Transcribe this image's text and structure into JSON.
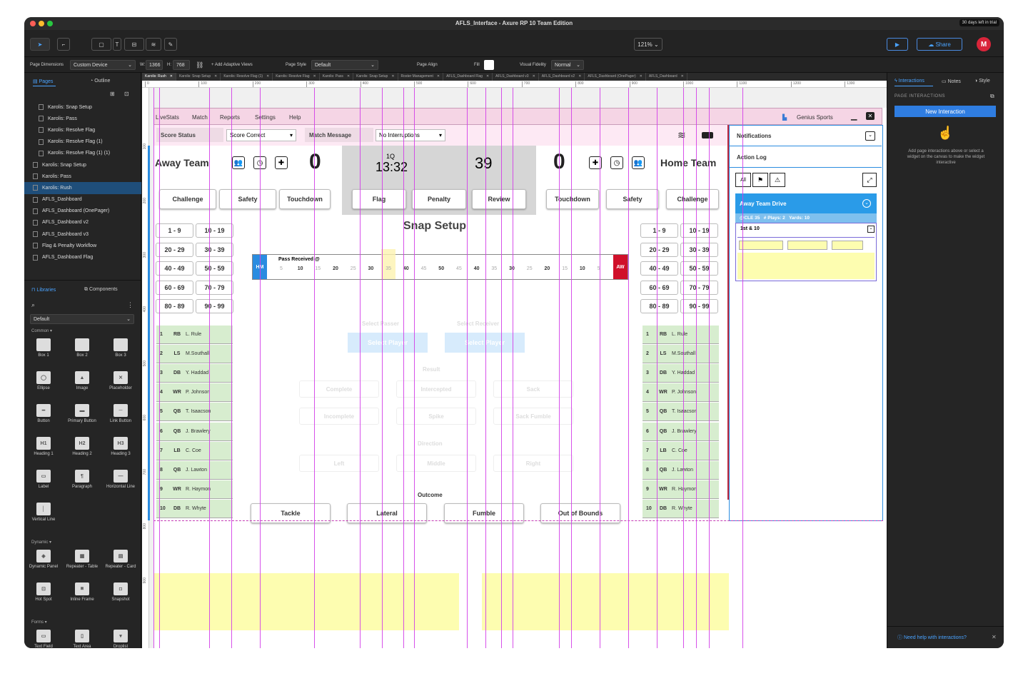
{
  "window": {
    "title": "AFLS_Interface - Axure RP 10 Team Edition",
    "trial": "30 days left in trial",
    "colors": {
      "red": "#ff5f57",
      "yellow": "#febc2e",
      "green": "#28c840",
      "accent": "#2f7de1"
    }
  },
  "toolbar": {
    "zoom": "121%",
    "share_label": "Share",
    "avatar": "M"
  },
  "toolbar2": {
    "page_dimensions_label": "Page Dimensions",
    "device": "Custom Device",
    "w_label": "W:",
    "w_value": "1366",
    "h_label": "H:",
    "h_value": "768",
    "adaptive": "+ Add Adaptive Views",
    "page_style_label": "Page Style",
    "page_style": "Default",
    "page_align_label": "Page Align",
    "fill_label": "Fill",
    "fidelity_label": "Visual Fidelity",
    "fidelity": "Normal"
  },
  "left": {
    "tab_pages": "Pages",
    "tab_outline": "Outline",
    "pages": [
      {
        "label": "Karolis: Snap Setup",
        "indent": true,
        "active": false
      },
      {
        "label": "Karolis: Pass",
        "indent": true,
        "active": false
      },
      {
        "label": "Karolis: Resolve Flag",
        "indent": true,
        "active": false
      },
      {
        "label": "Karolis: Resolve Flag (1)",
        "indent": true,
        "active": false
      },
      {
        "label": "Karolis: Resolve Flag (1) (1)",
        "indent": true,
        "active": false
      },
      {
        "label": "Karolis: Snap Setup",
        "indent": false,
        "active": false
      },
      {
        "label": "Karolis: Pass",
        "indent": false,
        "active": false
      },
      {
        "label": "Karolis: Rush",
        "indent": false,
        "active": true
      },
      {
        "label": "AFLS_Dashboard",
        "indent": false,
        "active": false
      },
      {
        "label": "AFLS_Dashboard (OnePager)",
        "indent": false,
        "active": false
      },
      {
        "label": "AFLS_Dashboard v2",
        "indent": false,
        "active": false
      },
      {
        "label": "AFLS_Dashboard v3",
        "indent": false,
        "active": false
      },
      {
        "label": "Flag & Penalty Workflow",
        "indent": false,
        "active": false
      },
      {
        "label": "AFLS_Dashboard Flag",
        "indent": false,
        "active": false
      }
    ],
    "tab_libraries": "Libraries",
    "tab_components": "Components",
    "library": "Default",
    "common_label": "Common",
    "common": [
      "Box 1",
      "Box 2",
      "Box 3",
      "Ellipse",
      "Image",
      "Placeholder",
      "Button",
      "Primary Button",
      "Link Button",
      "Heading 1",
      "Heading 2",
      "Heading 3",
      "Label",
      "Paragraph",
      "Horizontal Line",
      "Vertical Line"
    ],
    "dynamic_label": "Dynamic",
    "dynamic": [
      "Dynamic Panel",
      "Repeater - Table",
      "Repeater - Card",
      "Hot Spot",
      "Inline Frame",
      "Snapshot"
    ],
    "forms_label": "Forms",
    "forms": [
      "Text Field",
      "Text Area",
      "Droplist"
    ]
  },
  "right": {
    "tab_interactions": "Interactions",
    "tab_notes": "Notes",
    "tab_style": "Style",
    "section": "PAGE INTERACTIONS",
    "new_interaction": "New Interaction",
    "help_text": "Add page interactions above or select a widget on the canvas to make the widget interactive",
    "need_help": "Need help with interactions?"
  },
  "doc_tabs": [
    "Karolis: Rush",
    "Karolis: Snap Setup",
    "Karolis: Resolve Flag (1)",
    "Karolis: Resolve Flag",
    "Karolis: Pass",
    "Karolis: Snap Setup",
    "Roster Management",
    "AFLS_Dashboard Flag",
    "AFLS_Dashboard v3",
    "AFLS_Dashboard v2",
    "AFLS_Dashboard (OnePager)",
    "AFLS_Dashboard"
  ],
  "ruler": [
    "0",
    "100",
    "200",
    "300",
    "400",
    "500",
    "600",
    "700",
    "800",
    "900",
    "1000",
    "1100",
    "1200",
    "1300"
  ],
  "ruler_v": [
    "100",
    "200",
    "300",
    "400",
    "500",
    "600",
    "700",
    "800",
    "900"
  ],
  "mock": {
    "menu": [
      "LiveStats",
      "Match",
      "Reports",
      "Settings",
      "Help"
    ],
    "brand": "Genius Sports",
    "score_status_label": "Score Status",
    "score_status_value": "Score Correct",
    "match_message_label": "Match Message",
    "match_message_value": "No Interruptions",
    "away_team": "Away Team",
    "home_team": "Home Team",
    "away_score": "0",
    "home_score": "0",
    "quarter": "1Q",
    "clock": "13:32",
    "play_clock": "39",
    "away_buttons": [
      "Challenge",
      "Safety",
      "Touchdown"
    ],
    "center_buttons": [
      "Flag",
      "Penalty",
      "Review"
    ],
    "home_buttons": [
      "Touchdown",
      "Safety",
      "Challenge"
    ],
    "title": "Snap Setup",
    "jersey_ranges": [
      "1 - 9",
      "10 - 19",
      "20 - 29",
      "30 - 39",
      "40 - 49",
      "50 - 59",
      "60 - 69",
      "70 - 79",
      "80 - 89",
      "90 - 99"
    ],
    "roster": [
      {
        "num": "1",
        "pos": "RB",
        "name": "L. Rule"
      },
      {
        "num": "2",
        "pos": "LS",
        "name": "M.Southall"
      },
      {
        "num": "3",
        "pos": "DB",
        "name": "Y. Haddad"
      },
      {
        "num": "4",
        "pos": "WR",
        "name": "P. Johnson"
      },
      {
        "num": "5",
        "pos": "QB",
        "name": "T. Isaacson"
      },
      {
        "num": "6",
        "pos": "QB",
        "name": "J. Brawlery"
      },
      {
        "num": "7",
        "pos": "LB",
        "name": "C. Coe"
      },
      {
        "num": "8",
        "pos": "QB",
        "name": "J. Lawton"
      },
      {
        "num": "9",
        "pos": "WR",
        "name": "R. Haymon"
      },
      {
        "num": "10",
        "pos": "DB",
        "name": "R. Whyte"
      }
    ],
    "field": {
      "hm": "HM",
      "aw": "AW",
      "pass_received": "Pass Received @",
      "ticks": [
        "5",
        "10",
        "15",
        "20",
        "25",
        "30",
        "35",
        "40",
        "45",
        "50",
        "45",
        "40",
        "35",
        "30",
        "25",
        "20",
        "15",
        "10",
        "5"
      ]
    },
    "select_passer": "Select Passer",
    "select_receiver": "Select Receiver",
    "select_player": "Select Player",
    "result_label": "Result",
    "results": [
      "Complete",
      "Intercepted",
      "Sack",
      "Incomplete",
      "Spike",
      "Sack Fumble"
    ],
    "direction_label": "Direction",
    "directions": [
      "Left",
      "Middle",
      "Right"
    ],
    "outcome_label": "Outcome",
    "outcomes": [
      "Tackle",
      "Lateral",
      "Fumble",
      "Out of Bounds"
    ],
    "notifications": "Notifications",
    "action_log": "Action Log",
    "filter_all": "All",
    "drive_title": "Away Team Drive",
    "drive_info": "@CLE 35   # Plays: 2   Yards: 10",
    "down": "1st & 10"
  }
}
